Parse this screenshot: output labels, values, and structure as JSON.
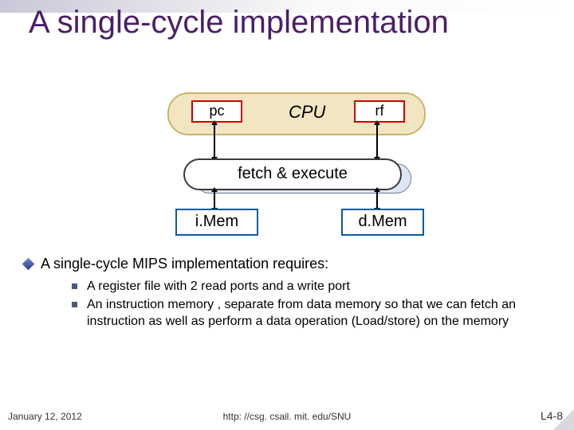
{
  "title": "A single-cycle implementation",
  "diagram": {
    "cpu_label": "CPU",
    "pc": "pc",
    "rf": "rf",
    "fetch_exec": "fetch & execute",
    "imem": "i.Mem",
    "dmem": "d.Mem"
  },
  "body": {
    "lead": "A single-cycle MIPS implementation requires:",
    "bullets": [
      "A register file with 2 read ports and a write port",
      "An instruction memory , separate from data memory so that we can fetch an instruction as well as perform a data operation (Load/store)  on the memory"
    ]
  },
  "footer": {
    "date": "January 12, 2012",
    "url": "http: //csg. csail. mit. edu/SNU",
    "page": "L4-8"
  }
}
